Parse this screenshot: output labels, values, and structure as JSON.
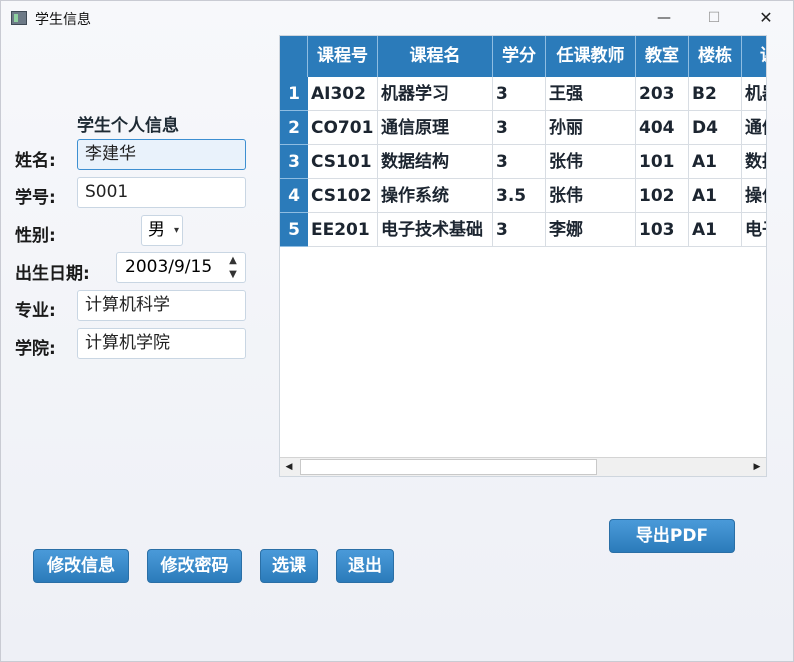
{
  "window": {
    "title": "学生信息",
    "controls": {
      "minimize": "—",
      "maximize": "☐",
      "close": "✕"
    }
  },
  "profile": {
    "section_title": "学生个人信息",
    "fields": {
      "name": {
        "label": "姓名:",
        "value": "李建华"
      },
      "student_id": {
        "label": "学号:",
        "value": "S001"
      },
      "gender": {
        "label": "性别:",
        "value": "男"
      },
      "birthdate": {
        "label": "出生日期:",
        "value": "2003/9/15"
      },
      "major": {
        "label": "专业:",
        "value": "计算机科学"
      },
      "college": {
        "label": "学院:",
        "value": "计算机学院"
      }
    }
  },
  "courses_table": {
    "columns": [
      "课程号",
      "课程名",
      "学分",
      "任课教师",
      "教室",
      "楼栋",
      "课"
    ],
    "rows": [
      {
        "num": "1",
        "cells": [
          "AI302",
          "机器学习",
          "3",
          "王强",
          "203",
          "B2",
          "机器"
        ]
      },
      {
        "num": "2",
        "cells": [
          "CO701",
          "通信原理",
          "3",
          "孙丽",
          "404",
          "D4",
          "通信"
        ]
      },
      {
        "num": "3",
        "cells": [
          "CS101",
          "数据结构",
          "3",
          "张伟",
          "101",
          "A1",
          "数据"
        ]
      },
      {
        "num": "4",
        "cells": [
          "CS102",
          "操作系统",
          "3.5",
          "张伟",
          "102",
          "A1",
          "操作"
        ]
      },
      {
        "num": "5",
        "cells": [
          "EE201",
          "电子技术基础",
          "3",
          "李娜",
          "103",
          "A1",
          "电子"
        ]
      }
    ],
    "accent_color": "#2b7bba"
  },
  "actions": {
    "export_pdf": "导出PDF",
    "edit_info": "修改信息",
    "change_password": "修改密码",
    "select_course": "选课",
    "exit": "退出"
  },
  "icons": {
    "spin_up": "▲",
    "spin_down": "▼",
    "combo_arrow": "▾",
    "scroll_left": "◀",
    "scroll_right": "▶"
  }
}
